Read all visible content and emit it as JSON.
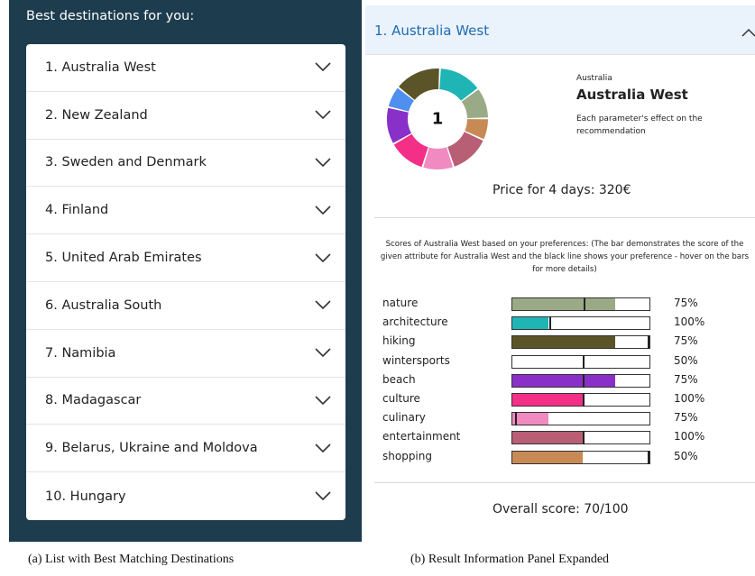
{
  "left": {
    "title": "Best destinations for you:",
    "items": [
      "1. Australia West",
      "2. New Zealand",
      "3. Sweden and Denmark",
      "4. Finland",
      "5. United Arab Emirates",
      "6. Australia South",
      "7. Namibia",
      "8. Madagascar",
      "9. Belarus, Ukraine and Moldova",
      "10. Hungary"
    ]
  },
  "detail": {
    "header_title": "1. Australia West",
    "rank": "1",
    "country": "Australia",
    "name": "Australia West",
    "effect_text": "Each parameter's effect on the recommendation",
    "price_text": "Price for 4 days: 320€",
    "scores_text": "Scores of Australia West based on your preferences: (The bar demonstrates the score of the given attribute for Australia West and the black line shows your preference - hover on the bars for more details)",
    "overall_text": "Overall score: 70/100",
    "donut_segments": [
      {
        "color": "#20b5b5",
        "weight": 0.14
      },
      {
        "color": "#9aaa86",
        "weight": 0.1
      },
      {
        "color": "#c78a55",
        "weight": 0.07
      },
      {
        "color": "#b85f76",
        "weight": 0.13
      },
      {
        "color": "#f08ac0",
        "weight": 0.1
      },
      {
        "color": "#f42f88",
        "weight": 0.12
      },
      {
        "color": "#8830c8",
        "weight": 0.12
      },
      {
        "color": "#4f8ff0",
        "weight": 0.07
      },
      {
        "color": "#5a5428",
        "weight": 0.15
      }
    ],
    "attributes": [
      {
        "name": "nature",
        "pct": "75%",
        "score": 0.75,
        "pref": 0.52,
        "color": "#9aaa86"
      },
      {
        "name": "architecture",
        "pct": "100%",
        "score": 0.26,
        "pref": 0.27,
        "color": "#20b5b5"
      },
      {
        "name": "hiking",
        "pct": "75%",
        "score": 0.75,
        "pref": 1.0,
        "color": "#5a5428"
      },
      {
        "name": "wintersports",
        "pct": "50%",
        "score": 0.0,
        "pref": 0.51,
        "color": "#cccccc"
      },
      {
        "name": "beach",
        "pct": "75%",
        "score": 0.75,
        "pref": 0.51,
        "color": "#8830c8"
      },
      {
        "name": "culture",
        "pct": "100%",
        "score": 0.51,
        "pref": 0.51,
        "color": "#f42f88"
      },
      {
        "name": "culinary",
        "pct": "75%",
        "score": 0.26,
        "pref": 0.02,
        "color": "#f08ac0"
      },
      {
        "name": "entertainment",
        "pct": "100%",
        "score": 0.51,
        "pref": 0.51,
        "color": "#b85f76"
      },
      {
        "name": "shopping",
        "pct": "50%",
        "score": 0.51,
        "pref": 1.0,
        "color": "#c78a55"
      }
    ]
  },
  "captions": {
    "a": "(a) List with Best Matching Destinations",
    "b": "(b) Result Information Panel Expanded"
  }
}
